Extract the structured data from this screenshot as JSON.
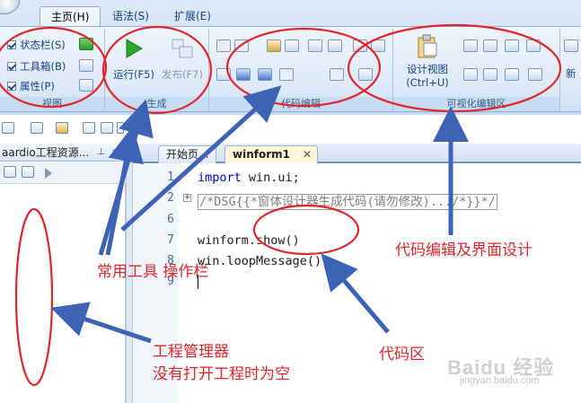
{
  "ribbon": {
    "tabs": [
      "主页(H)",
      "语法(S)",
      "扩展(E)"
    ],
    "view_group": {
      "label": "视图",
      "checkboxes": [
        "状态栏(S)",
        "工具箱(B)",
        "属性(P)"
      ]
    },
    "build_group": {
      "label": "生成",
      "run_label": "运行(F5)",
      "publish_label": "发布(F7)"
    },
    "code_group": {
      "label": "代码编辑"
    },
    "visual_group": {
      "label": "可视化编辑区",
      "design_label": "设计视图",
      "design_shortcut": "(Ctrl+U)"
    },
    "new_label": "新"
  },
  "project_panel": {
    "title": "aardio工程资源...",
    "pin_icon": "pin-icon",
    "close_icon": "close-icon"
  },
  "editor": {
    "tabs": [
      "开始页...",
      "winform1"
    ],
    "line_numbers": [
      "1",
      "2",
      "6",
      "7",
      "8",
      "9"
    ],
    "lines": {
      "l1_kw": "import",
      "l1_rest": " win.ui;",
      "l2": "/*DSG{{*窗体设计器生成代码(请勿修改).../*}}*/",
      "l7": "winform.show()",
      "l8": "win.loopMessage()"
    }
  },
  "annotations": {
    "toolbar": "常用工具 操作栏",
    "code_design": "代码编辑及界面设计",
    "project_manager": "工程管理器",
    "project_empty": "没有打开工程时为空",
    "code_area": "代码区"
  },
  "watermark": "Baidu 经验",
  "watermark_sub": "jingyan.baidu.com",
  "colors": {
    "annotation": "#e0262a",
    "arrow": "#3d63b7",
    "keyword": "#0000c8",
    "ribbon": "#dfeaf8"
  }
}
